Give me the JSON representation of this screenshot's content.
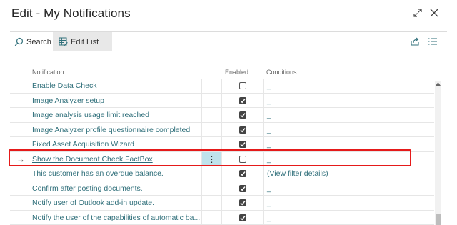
{
  "window": {
    "title": "Edit - My Notifications",
    "expand_icon": "expand-diagonal-icon",
    "close_icon": "close-icon"
  },
  "toolbar": {
    "search_label": "Search",
    "edit_list_label": "Edit List",
    "share_icon": "share-icon",
    "list_icon": "list-view-icon"
  },
  "columns": {
    "notification": "Notification",
    "enabled": "Enabled",
    "conditions": "Conditions"
  },
  "rows": [
    {
      "name": "Enable Data Check",
      "enabled": false,
      "conditions": "_"
    },
    {
      "name": "Image Analyzer setup",
      "enabled": true,
      "conditions": "_"
    },
    {
      "name": "Image analysis usage limit reached",
      "enabled": true,
      "conditions": "_"
    },
    {
      "name": "Image Analyzer profile questionnaire completed",
      "enabled": true,
      "conditions": "_"
    },
    {
      "name": "Fixed Asset Acquisition Wizard",
      "enabled": true,
      "conditions": "_"
    },
    {
      "name": "Show the Document Check FactBox",
      "enabled": false,
      "conditions": "_",
      "current": true
    },
    {
      "name": "This customer has an overdue balance.",
      "enabled": true,
      "conditions": "(View filter details)"
    },
    {
      "name": "Confirm after posting documents.",
      "enabled": true,
      "conditions": "_"
    },
    {
      "name": "Notify user of Outlook add-in update.",
      "enabled": true,
      "conditions": "_"
    },
    {
      "name": "Notify the user of the capabilities of automatic ba...",
      "enabled": true,
      "conditions": "_"
    }
  ],
  "current_row_marker": "→",
  "row_actions_glyph": "⋮",
  "colors": {
    "link": "#2f6f7a",
    "current_row_action_bg": "#bfe3ec",
    "highlight_border": "#e51a1a"
  }
}
